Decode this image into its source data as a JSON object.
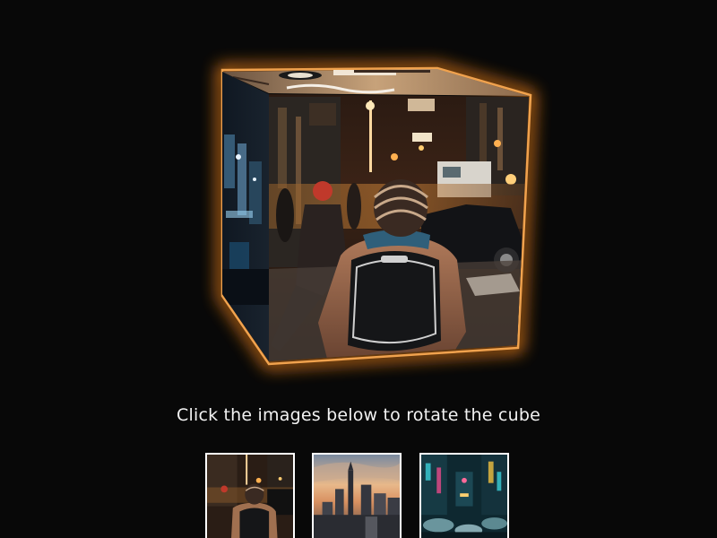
{
  "caption": "Click the images below to rotate the cube",
  "accent_color": "#ff8a1c",
  "cube": {
    "faces": [
      {
        "name": "front",
        "image": "night-street-backpacker-photo"
      },
      {
        "name": "left",
        "image": "night-city-lights-photo"
      },
      {
        "name": "top",
        "image": "sketch-artwork-photo"
      }
    ]
  },
  "thumbnails": [
    {
      "image": "night-street-backpacker-photo"
    },
    {
      "image": "city-skyline-sunset-photo"
    },
    {
      "image": "neon-street-umbrellas-photo"
    }
  ]
}
